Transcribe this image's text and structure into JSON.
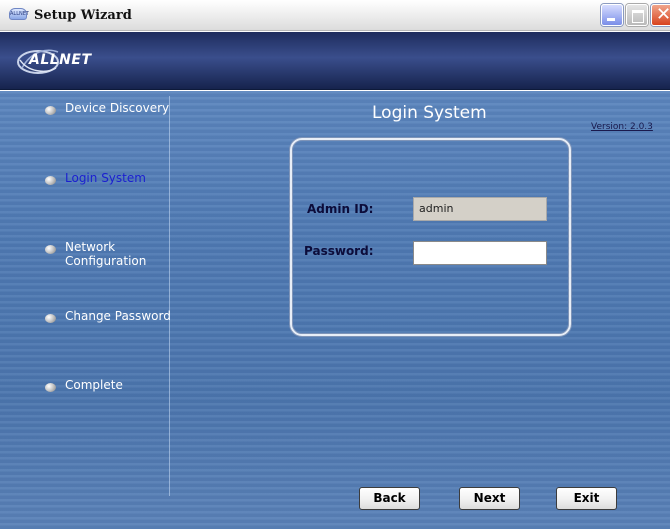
{
  "window": {
    "title": "Setup Wizard",
    "icon_text": "ALLNET",
    "controls": {
      "minimize": "minimize-icon",
      "maximize": "maximize-icon",
      "close": "close-icon",
      "close_glyph": "✕"
    }
  },
  "banner": {
    "logo_text": "ALLNET"
  },
  "sidebar": {
    "steps": [
      {
        "label": "Device Discovery",
        "active": false
      },
      {
        "label": "Login System",
        "active": true
      },
      {
        "label": "Network Configuration",
        "active": false
      },
      {
        "label": "Change Password",
        "active": false
      },
      {
        "label": "Complete",
        "active": false
      }
    ]
  },
  "main": {
    "title": "Login System",
    "version": "Version: 2.0.3",
    "form": {
      "admin_id_label": "Admin ID:",
      "admin_id_value": "admin",
      "password_label": "Password:",
      "password_value": ""
    }
  },
  "buttons": {
    "back": "Back",
    "next": "Next",
    "exit": "Exit"
  },
  "colors": {
    "background": "#4f7ab3",
    "banner": "#1f2d5e",
    "active_step": "#1b1fd0"
  }
}
